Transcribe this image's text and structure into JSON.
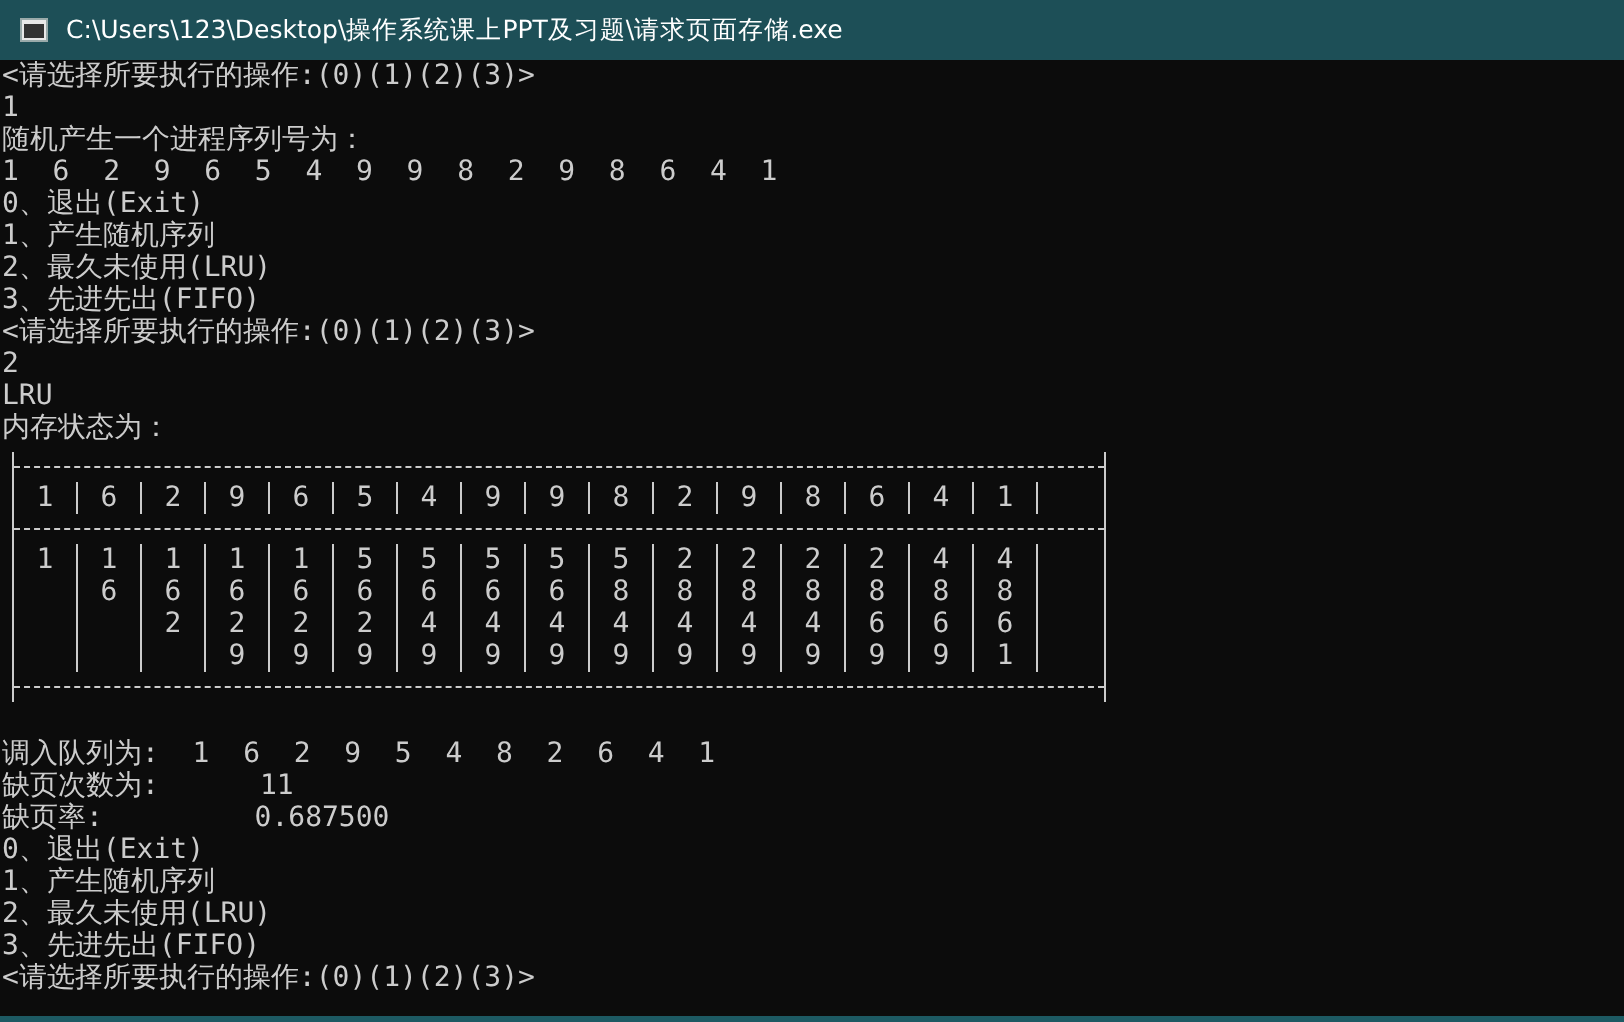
{
  "window": {
    "title": "C:\\Users\\123\\Desktop\\操作系统课上PPT及习题\\请求页面存储.exe"
  },
  "lines_before": [
    "<请选择所要执行的操作:(0)(1)(2)(3)>",
    "1",
    "随机产生一个进程序列号为：",
    "1  6  2  9  6  5  4  9  9  8  2  9  8  6  4  1",
    "0、退出(Exit)",
    "1、产生随机序列",
    "2、最久未使用(LRU)",
    "3、先进先出(FIFO)",
    "<请选择所要执行的操作:(0)(1)(2)(3)>",
    "2",
    "LRU",
    "内存状态为："
  ],
  "table": {
    "reference_row": [
      "1",
      "6",
      "2",
      "9",
      "6",
      "5",
      "4",
      "9",
      "9",
      "8",
      "2",
      "9",
      "8",
      "6",
      "4",
      "1"
    ],
    "frames": [
      [
        "1"
      ],
      [
        "1",
        "6"
      ],
      [
        "1",
        "6",
        "2"
      ],
      [
        "1",
        "6",
        "2",
        "9"
      ],
      [
        "1",
        "6",
        "2",
        "9"
      ],
      [
        "5",
        "6",
        "2",
        "9"
      ],
      [
        "5",
        "6",
        "4",
        "9"
      ],
      [
        "5",
        "6",
        "4",
        "9"
      ],
      [
        "5",
        "6",
        "4",
        "9"
      ],
      [
        "5",
        "8",
        "4",
        "9"
      ],
      [
        "2",
        "8",
        "4",
        "9"
      ],
      [
        "2",
        "8",
        "4",
        "9"
      ],
      [
        "2",
        "8",
        "4",
        "9"
      ],
      [
        "2",
        "8",
        "6",
        "9"
      ],
      [
        "4",
        "8",
        "6",
        "9"
      ],
      [
        "4",
        "8",
        "6",
        "1"
      ]
    ]
  },
  "lines_after": [
    "调入队列为:  1  6  2  9  5  4  8  2  6  4  1",
    "缺页次数为:      11",
    "缺页率:         0.687500",
    "0、退出(Exit)",
    "1、产生随机序列",
    "2、最久未使用(LRU)",
    "3、先进先出(FIFO)",
    "<请选择所要执行的操作:(0)(1)(2)(3)>"
  ]
}
